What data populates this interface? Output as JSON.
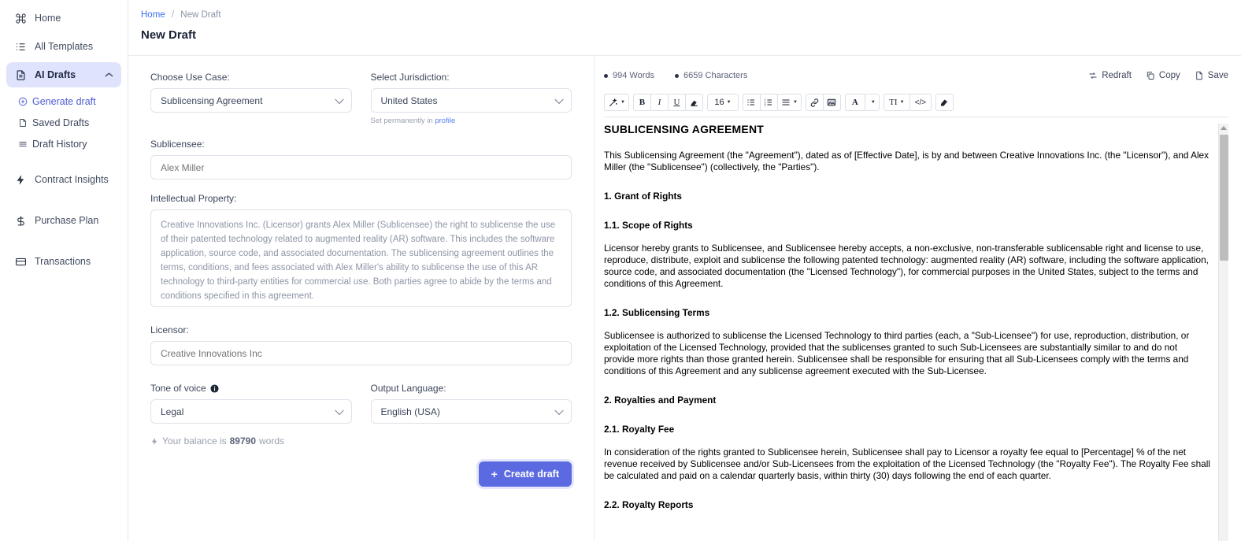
{
  "sidebar": {
    "items": [
      {
        "label": "Home",
        "icon": "command-icon"
      },
      {
        "label": "All Templates",
        "icon": "list-icon"
      },
      {
        "label": "AI Drafts",
        "icon": "document-icon"
      }
    ],
    "subitems": [
      {
        "label": "Generate draft",
        "icon": "plus-circle-icon"
      },
      {
        "label": "Saved Drafts",
        "icon": "file-icon"
      },
      {
        "label": "Draft History",
        "icon": "menu-icon"
      }
    ],
    "lower": [
      {
        "label": "Contract Insights",
        "icon": "bolt-icon"
      },
      {
        "label": "Purchase Plan",
        "icon": "dollar-icon"
      },
      {
        "label": "Transactions",
        "icon": "card-icon"
      }
    ],
    "active_accent": "#dfe3fb"
  },
  "breadcrumb": {
    "home": "Home",
    "separator": "/",
    "current": "New Draft"
  },
  "page": {
    "title": "New Draft"
  },
  "form": {
    "use_case_label": "Choose Use Case:",
    "use_case_value": "Sublicensing Agreement",
    "jurisdiction_label": "Select Jurisdiction:",
    "jurisdiction_value": "United States",
    "jurisdiction_hint_prefix": "Set permanently in ",
    "jurisdiction_hint_link": "profile",
    "sublicensee_label": "Sublicensee:",
    "sublicensee_placeholder": "Alex Miller",
    "ip_label": "Intellectual Property:",
    "ip_value": "Creative Innovations Inc. (Licensor) grants Alex Miller (Sublicensee) the right to sublicense the use of their patented technology related to augmented reality (AR) software. This includes the software application, source code, and associated documentation. The sublicensing agreement outlines the terms, conditions, and fees associated with Alex Miller's ability to sublicense the use of this AR technology to third-party entities for commercial use. Both parties agree to abide by the terms and conditions specified in this agreement.",
    "licensor_label": "Licensor:",
    "licensor_placeholder": "Creative Innovations Inc",
    "tone_label": "Tone of voice",
    "tone_value": "Legal",
    "language_label": "Output Language:",
    "language_value": "English (USA)",
    "balance_prefix": "Your balance is",
    "balance_amount": "89790",
    "balance_suffix": "words",
    "create_button": "Create draft",
    "create_button_accent": "#5b6ae0"
  },
  "editor": {
    "words": "994 Words",
    "characters": "6659 Characters",
    "actions": {
      "redraft": "Redraft",
      "copy": "Copy",
      "save": "Save"
    },
    "toolbar": {
      "ai": "magic-wand-icon",
      "bold": "B",
      "italic": "I",
      "underline": "U",
      "highlight": "highlighter-icon",
      "font_size": "16",
      "bullet_list": "bullet-list-icon",
      "numbered_list": "numbered-list-icon",
      "align": "align-icon",
      "link": "link-icon",
      "image": "image-icon",
      "font_color": "A",
      "text_style": "TI",
      "code": "</>",
      "clear_format": "eraser-icon"
    }
  },
  "document": {
    "title": "SUBLICENSING AGREEMENT",
    "blocks": [
      {
        "type": "p",
        "text": "This Sublicensing Agreement (the \"Agreement\"), dated as of [Effective Date], is by and between Creative Innovations Inc. (the \"Licensor\"), and Alex Miller (the \"Sublicensee\") (collectively, the \"Parties\")."
      },
      {
        "type": "h2",
        "text": "1. Grant of Rights"
      },
      {
        "type": "h2",
        "text": "1.1. Scope of Rights"
      },
      {
        "type": "p",
        "text": "Licensor hereby grants to Sublicensee, and Sublicensee hereby accepts, a non-exclusive, non-transferable sublicensable right and license to use, reproduce, distribute, exploit and sublicense the following patented technology: augmented reality (AR) software, including the software application, source code, and associated documentation (the \"Licensed Technology\"), for commercial purposes in the United States, subject to the terms and conditions of this Agreement."
      },
      {
        "type": "h2",
        "text": "1.2. Sublicensing Terms"
      },
      {
        "type": "p",
        "text": "Sublicensee is authorized to sublicense the Licensed Technology to third parties (each, a \"Sub-Licensee\") for use, reproduction, distribution, or exploitation of the Licensed Technology, provided that the sublicenses granted to such Sub-Licensees are substantially similar to and do not provide more rights than those granted herein. Sublicensee shall be responsible for ensuring that all Sub-Licensees comply with the terms and conditions of this Agreement and any sublicense agreement executed with the Sub-Licensee."
      },
      {
        "type": "h2",
        "text": "2. Royalties and Payment"
      },
      {
        "type": "h2",
        "text": "2.1. Royalty Fee"
      },
      {
        "type": "p",
        "text": "In consideration of the rights granted to Sublicensee herein, Sublicensee shall pay to Licensor a royalty fee equal to [Percentage] % of the net revenue received by Sublicensee and/or Sub-Licensees from the exploitation of the Licensed Technology (the \"Royalty Fee\"). The Royalty Fee shall be calculated and paid on a calendar quarterly basis, within thirty (30) days following the end of each quarter."
      },
      {
        "type": "h2",
        "text": "2.2. Royalty Reports"
      }
    ]
  }
}
